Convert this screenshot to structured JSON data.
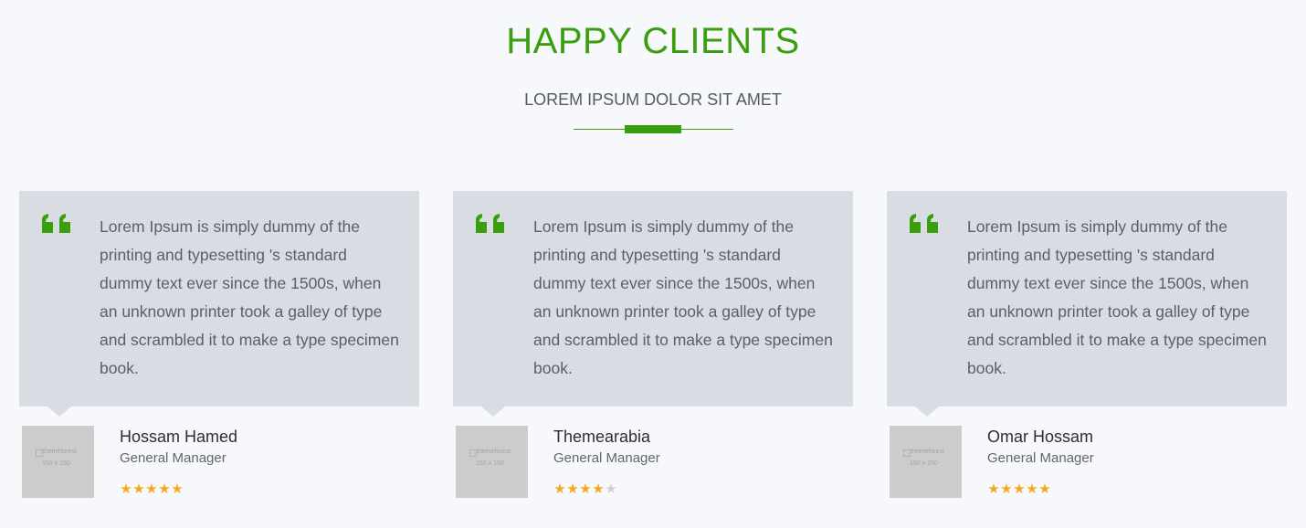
{
  "section": {
    "title": "HAPPY CLIENTS",
    "subtitle": "LOREM IPSUM DOLOR SIT AMET"
  },
  "colors": {
    "accent": "#3a9f0e",
    "card_background": "#d9dce2",
    "star_on": "#f5a623",
    "star_off": "#cfd1d6"
  },
  "testimonials": [
    {
      "text": "Lorem Ipsum is simply dummy of the printing and typesetting 's standard dummy text ever since the 1500s, when an unknown printer took a galley of type and scrambled it to make a type specimen book.",
      "name": "Hossam Hamed",
      "role": "General Manager",
      "rating": 5,
      "rating_max": 5,
      "avatar": {
        "brand": "themeforest",
        "size": "150 x 150"
      }
    },
    {
      "text": "Lorem Ipsum is simply dummy of the printing and typesetting 's standard dummy text ever since the 1500s, when an unknown printer took a galley of type and scrambled it to make a type specimen book.",
      "name": "Themearabia",
      "role": "General Manager",
      "rating": 4,
      "rating_max": 5,
      "avatar": {
        "brand": "themeforest",
        "size": "150 x 150"
      }
    },
    {
      "text": "Lorem Ipsum is simply dummy of the printing and typesetting 's standard dummy text ever since the 1500s, when an unknown printer took a galley of type and scrambled it to make a type specimen book.",
      "name": "Omar Hossam",
      "role": "General Manager",
      "rating": 5,
      "rating_max": 5,
      "avatar": {
        "brand": "themeforest",
        "size": "150 x 150"
      }
    }
  ]
}
